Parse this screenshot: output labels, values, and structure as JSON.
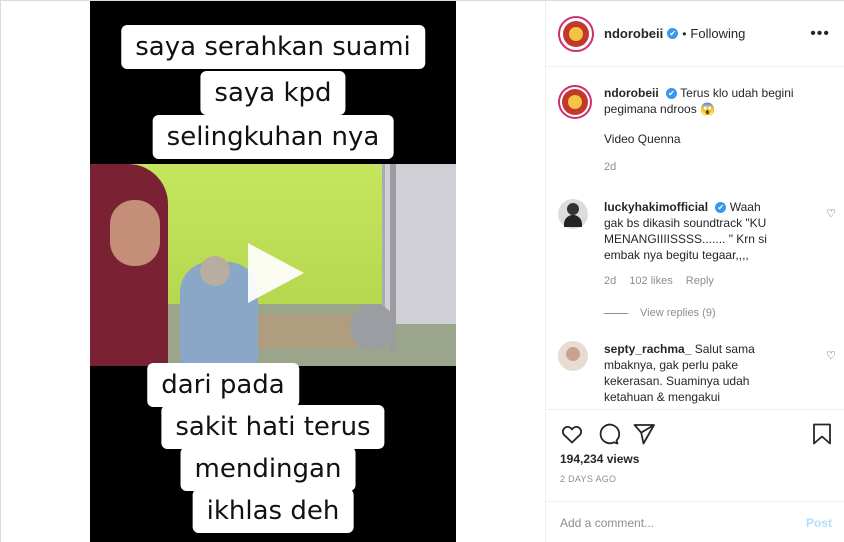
{
  "video": {
    "caption_top": [
      "saya serahkan suami",
      "saya kpd",
      "selingkuhan nya"
    ],
    "caption_bottom": [
      "dari pada",
      "sakit hati terus",
      "mendingan",
      "ikhlas deh"
    ]
  },
  "header": {
    "username": "ndorobeii",
    "verified_mark": "✔",
    "separator": "•",
    "follow_status": "Following",
    "more": "•••"
  },
  "caption": {
    "username": "ndorobeii",
    "text": "Terus klo udah begini pegimana ndroos 😱",
    "extra": "Video Quenna",
    "time": "2d"
  },
  "comments": [
    {
      "username": "luckyhakimofficial",
      "text": "Waah gak bs dikasih soundtrack \"KU MENANGIIIISSSS....... \" Krn si embak nya begitu tegaar,,,,",
      "time": "2d",
      "likes": "102 likes",
      "reply": "Reply",
      "view_replies": "View replies (9)"
    },
    {
      "username": "septy_rachma_",
      "text": "Salut sama mbaknya, gak perlu pake kekerasan. Suaminya udah ketahuan & mengakui"
    }
  ],
  "actions": {
    "views": "194,234 views",
    "time_ago": "2 DAYS AGO"
  },
  "add_comment": {
    "placeholder": "Add a comment...",
    "post_label": "Post"
  },
  "colors": {
    "verified": "#3897f0",
    "post_button": "#b2dffc",
    "muted": "#8e8e8e"
  }
}
